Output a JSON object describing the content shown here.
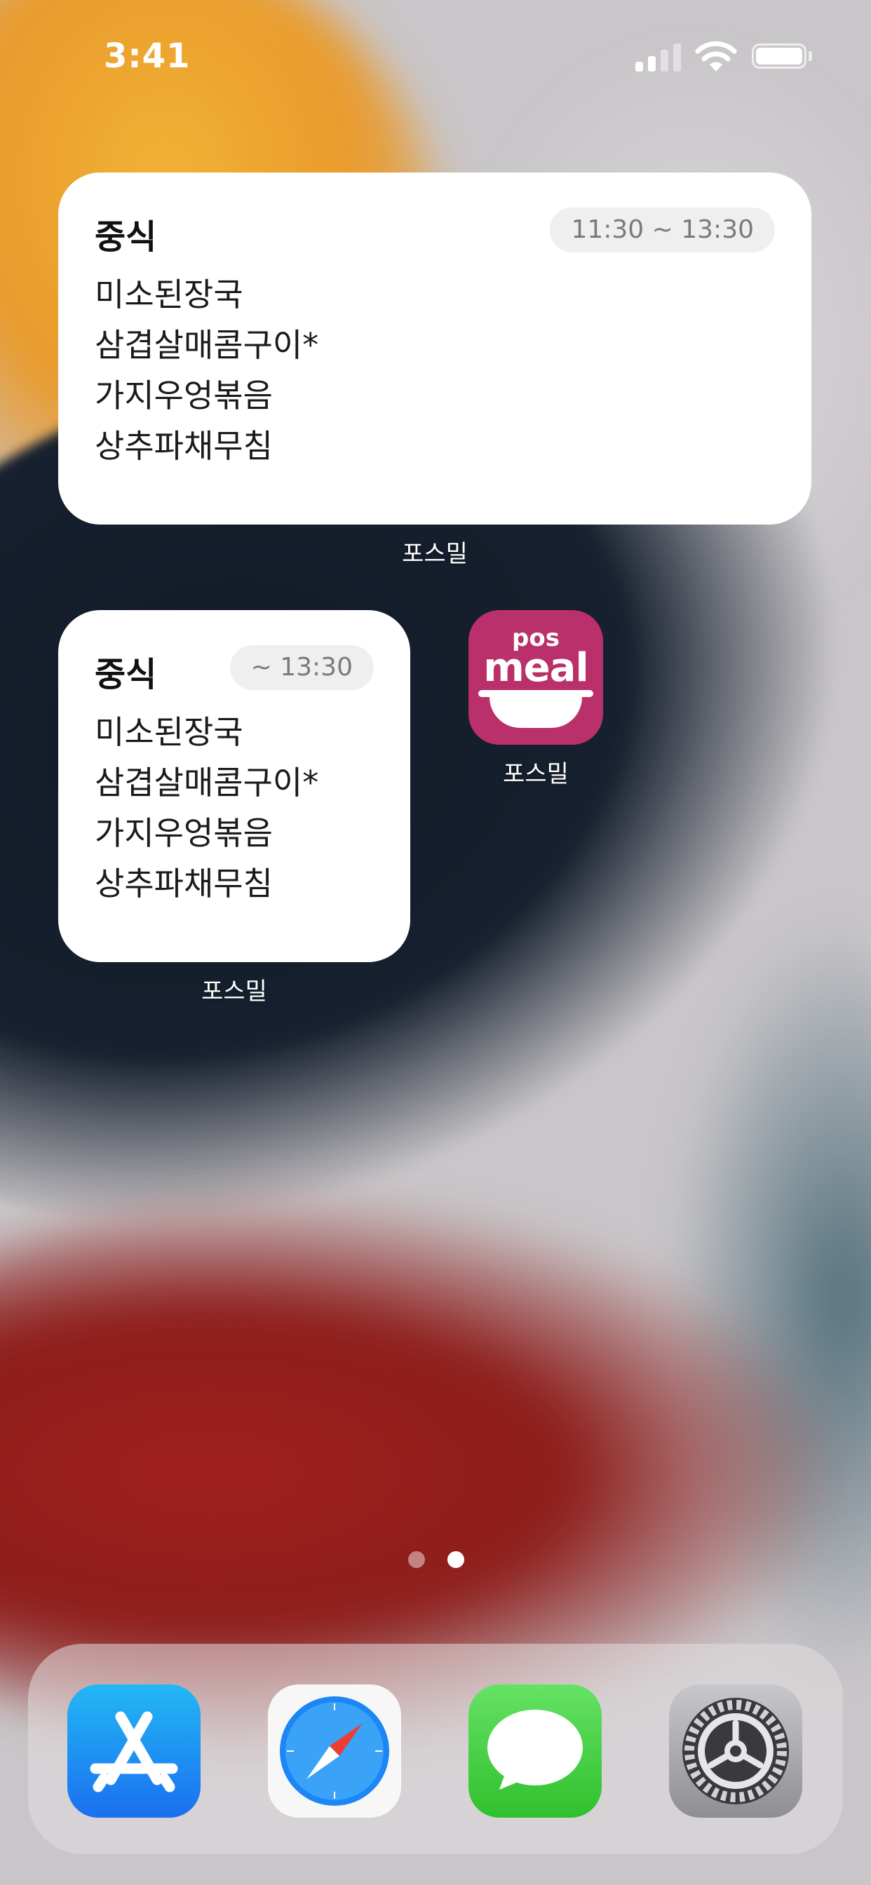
{
  "status_bar": {
    "time": "3:41",
    "signal_icon": "cellular-signal-icon",
    "wifi_icon": "wifi-icon",
    "battery_icon": "battery-icon"
  },
  "widgets": {
    "medium": {
      "title": "중식",
      "time": "11:30 ~ 13:30",
      "menu": [
        "미소된장국",
        "삼겹살매콤구이*",
        "가지우엉볶음",
        "상추파채무침"
      ],
      "label": "포스밀"
    },
    "small": {
      "title": "중식",
      "time": "~ 13:30",
      "menu": [
        "미소된장국",
        "삼겹살매콤구이*",
        "가지우엉볶음",
        "상추파채무침"
      ],
      "label": "포스밀"
    }
  },
  "app": {
    "logo_top": "pos",
    "logo_bottom": "meal",
    "label": "포스밀",
    "icon_color": "#b9306a"
  },
  "page_indicator": {
    "pages": 2,
    "current": 2
  },
  "dock": {
    "apps": [
      {
        "name": "App Store",
        "icon": "app-store-icon"
      },
      {
        "name": "Safari",
        "icon": "safari-icon"
      },
      {
        "name": "Messages",
        "icon": "messages-icon"
      },
      {
        "name": "Settings",
        "icon": "settings-icon"
      }
    ]
  }
}
